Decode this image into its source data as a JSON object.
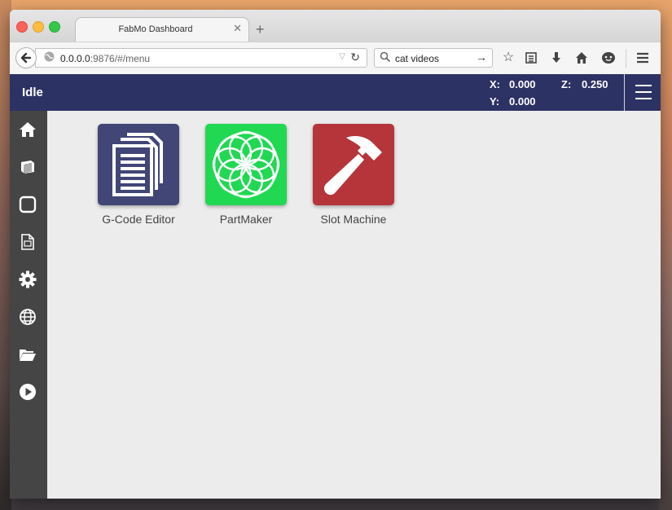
{
  "browser": {
    "tab_title": "FabMo Dashboard",
    "url_host": "0.0.0.0",
    "url_rest": ":9876/#/menu",
    "search_value": "cat videos",
    "new_tab_symbol": "+",
    "close_tab_symbol": "✕",
    "toolbar_icons": [
      "bookmark-star-icon",
      "reading-list-icon",
      "download-icon",
      "home-icon",
      "chat-icon",
      "menu-icon"
    ]
  },
  "header": {
    "status": "Idle",
    "x_label": "X:",
    "x_value": "0.000",
    "y_label": "Y:",
    "y_value": "0.000",
    "z_label": "Z:",
    "z_value": "0.250"
  },
  "sidebar": {
    "items": [
      {
        "icon": "home-icon"
      },
      {
        "icon": "jobs-icon"
      },
      {
        "icon": "stop-square-icon"
      },
      {
        "icon": "file-icon"
      },
      {
        "icon": "gear-icon"
      },
      {
        "icon": "globe-icon"
      },
      {
        "icon": "folder-open-icon"
      },
      {
        "icon": "play-icon"
      }
    ]
  },
  "apps": [
    {
      "label": "G-Code Editor",
      "color": "#414677",
      "icon": "documents-icon"
    },
    {
      "label": "PartMaker",
      "color": "#21d853",
      "icon": "spirograph-icon"
    },
    {
      "label": "Slot Machine",
      "color": "#b5353a",
      "icon": "hammer-icon"
    }
  ]
}
